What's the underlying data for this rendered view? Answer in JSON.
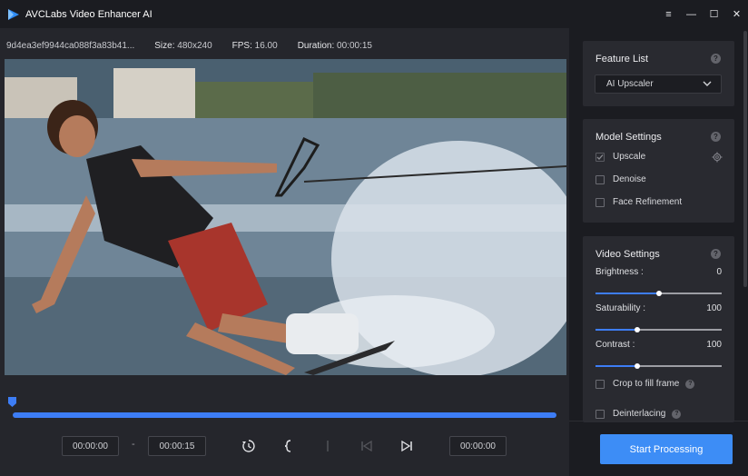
{
  "app": {
    "title": "AVCLabs Video Enhancer AI"
  },
  "window_controls": {
    "menu": "≡",
    "minimize": "—",
    "maximize": "☐",
    "close": "✕"
  },
  "info_bar": {
    "file_name": "9d4ea3ef9944ca088f3a83b41...",
    "size_label": "Size:",
    "size_value": "480x240",
    "fps_label": "FPS:",
    "fps_value": "16.00",
    "duration_label": "Duration:",
    "duration_value": "00:00:15"
  },
  "timeline": {
    "progress_fraction": 1.0
  },
  "controls": {
    "start_time": "00:00:00",
    "separator": "-",
    "end_time": "00:00:15",
    "current_time": "00:00:00",
    "icons": [
      "history-icon",
      "mark-in-icon",
      "mark-out-icon",
      "step-back-icon",
      "play-step-icon"
    ]
  },
  "feature_list": {
    "title": "Feature List",
    "help": "?",
    "selected": "AI Upscaler"
  },
  "model_settings": {
    "title": "Model Settings",
    "help": "?",
    "options": [
      {
        "label": "Upscale",
        "checked": true
      },
      {
        "label": "Denoise",
        "checked": false
      },
      {
        "label": "Face Refinement",
        "checked": false
      }
    ]
  },
  "video_settings": {
    "title": "Video Settings",
    "help": "?",
    "sliders": [
      {
        "label": "Brightness :",
        "value": "0",
        "fraction": 0.5
      },
      {
        "label": "Saturability :",
        "value": "100",
        "fraction": 0.33
      },
      {
        "label": "Contrast :",
        "value": "100",
        "fraction": 0.33
      }
    ],
    "crop_label": "Crop to fill frame",
    "deinterlace_label": "Deinterlacing"
  },
  "start_button": {
    "label": "Start Processing"
  },
  "colors": {
    "accent": "#3d7df6",
    "button": "#3d8df6",
    "panel": "#292a30",
    "background": "#1b1c21"
  }
}
